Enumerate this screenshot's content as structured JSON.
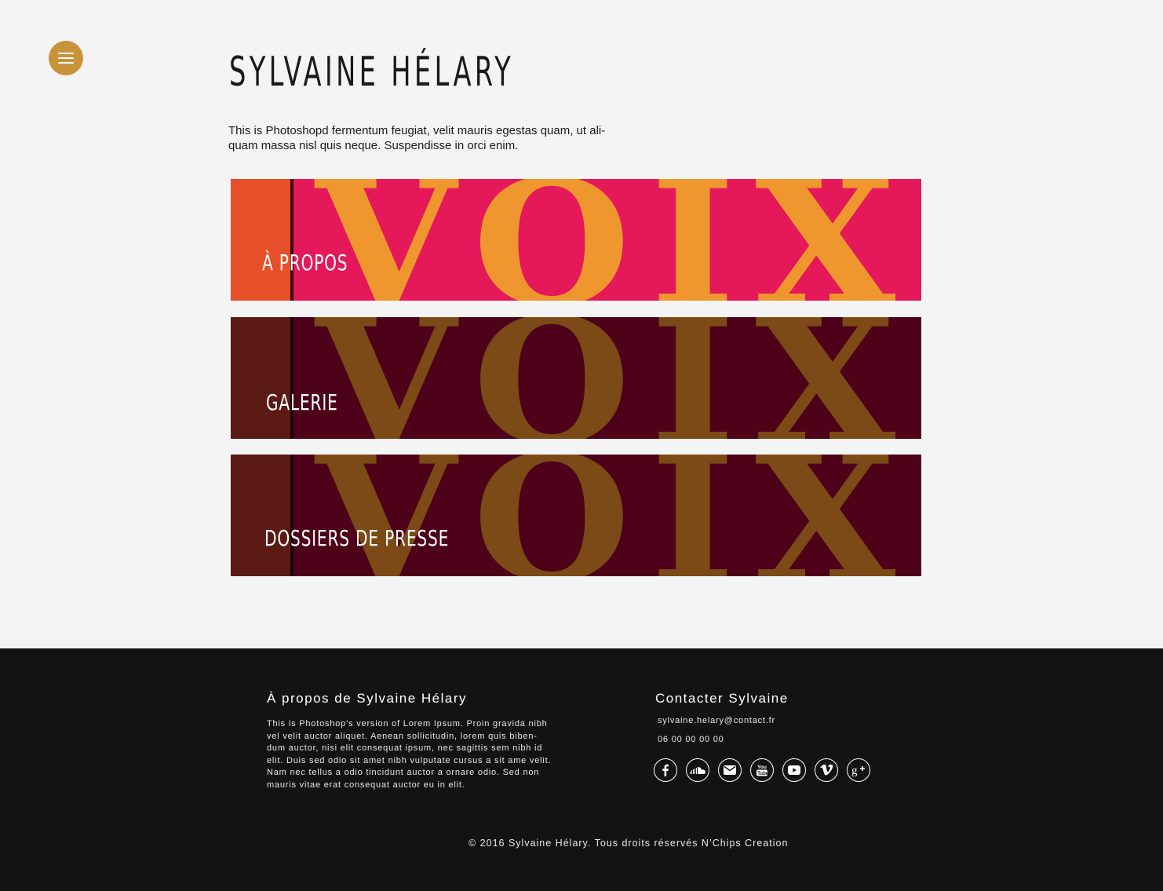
{
  "header": {
    "title": "SYLVAINE HÉLARY",
    "intro_line1": "This is Photoshopd fermentum feugiat, velit mauris egestas quam, ut ali-",
    "intro_line2": "quam massa nisl quis neque. Suspendisse in orci enim."
  },
  "banners": [
    {
      "label": "À PROPOS",
      "word": "VOIX"
    },
    {
      "label": "GALERIE",
      "word": "VOIX"
    },
    {
      "label": "DOSSIERS DE PRESSE",
      "word": "VOIX"
    }
  ],
  "footer": {
    "about_title": "À propos de Sylvaine Hélary",
    "about_lines": [
      "This is Photoshop’s version  of Lorem Ipsum. Proin gravida nibh",
      "vel velit auctor aliquet. Aenean sollicitudin, lorem quis biben-",
      "dum auctor, nisi elit consequat ipsum, nec sagittis sem nibh id",
      "elit. Duis sed odio sit amet nibh vulputate cursus a sit ame velit.",
      "Nam nec tellus a odio tincidunt auctor a ornare odio. Sed non",
      "mauris vitae erat consequat auctor eu in elit."
    ],
    "contact_title": "Contacter Sylvaine",
    "email": "sylvaine.helary@contact.fr",
    "phone": "06 00 00 00 00",
    "socials": [
      "facebook-icon",
      "soundcloud-icon",
      "mail-icon",
      "youtube-icon",
      "youtube-play-icon",
      "vimeo-icon",
      "google-plus-icon"
    ],
    "copyright": "© 2016 Sylvaine Hélary. Tous droits réservés N’Chips Creation"
  },
  "colors": {
    "accent": "#c9933a",
    "banner_active": "#e5185a",
    "banner_dark": "#4e0219",
    "footer_bg": "#131313"
  }
}
